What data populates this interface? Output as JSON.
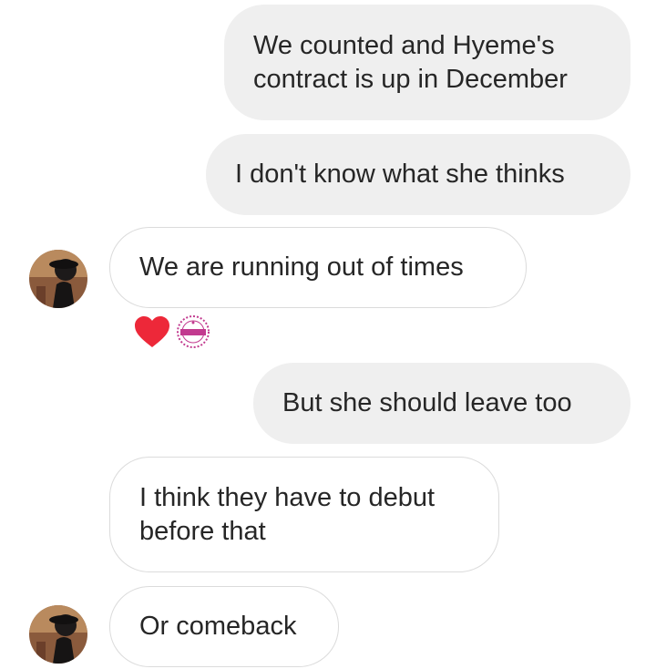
{
  "messages": [
    {
      "sender": "me",
      "lines": [
        "We counted and Hyeme's",
        "contract is up in December"
      ]
    },
    {
      "sender": "me",
      "lines": [
        "I don't know what she thinks"
      ]
    },
    {
      "sender": "them",
      "lines": [
        "We are running out of times"
      ],
      "reactions": [
        "heart",
        "sticker-badge"
      ]
    },
    {
      "sender": "me",
      "lines": [
        "But she should leave too"
      ]
    },
    {
      "sender": "them",
      "lines": [
        "I think they have to debut",
        "before that"
      ]
    },
    {
      "sender": "them",
      "lines": [
        "Or comeback"
      ]
    }
  ],
  "colors": {
    "outgoing_bubble": "#efefef",
    "incoming_border": "#dbdbdb",
    "reaction_heart": "#ed2839"
  }
}
